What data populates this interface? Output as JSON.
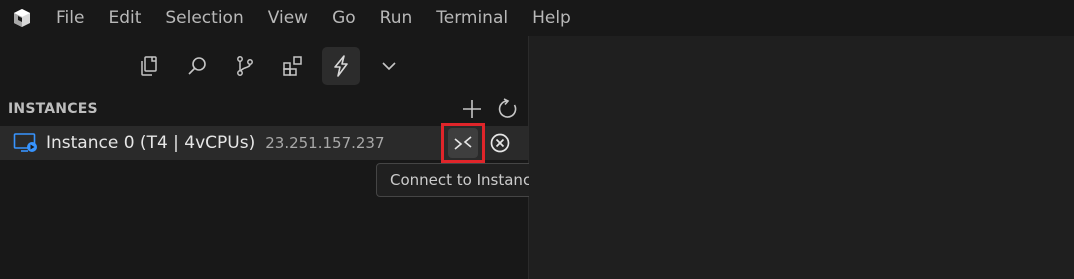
{
  "menubar": {
    "items": [
      "File",
      "Edit",
      "Selection",
      "View",
      "Go",
      "Run",
      "Terminal",
      "Help"
    ]
  },
  "activity": {
    "icons": [
      "explorer-icon",
      "search-icon",
      "source-control-icon",
      "extensions-icon",
      "remote-lightning-icon",
      "chevron-down-icon"
    ],
    "active": "remote-lightning-icon"
  },
  "instances": {
    "title": "INSTANCES",
    "actions": [
      "plus-icon",
      "refresh-icon"
    ],
    "items": [
      {
        "name": "Instance 0 (T4 | 4vCPUs)",
        "ip": "23.251.157.237",
        "icon": "vm-monitor-icon"
      }
    ]
  },
  "tooltip": {
    "text": "Connect to Instance"
  },
  "colors": {
    "background": "#181818",
    "row_highlight": "#2a2a2a",
    "accent_blue": "#3794ff",
    "highlight_red": "#e0252a"
  }
}
